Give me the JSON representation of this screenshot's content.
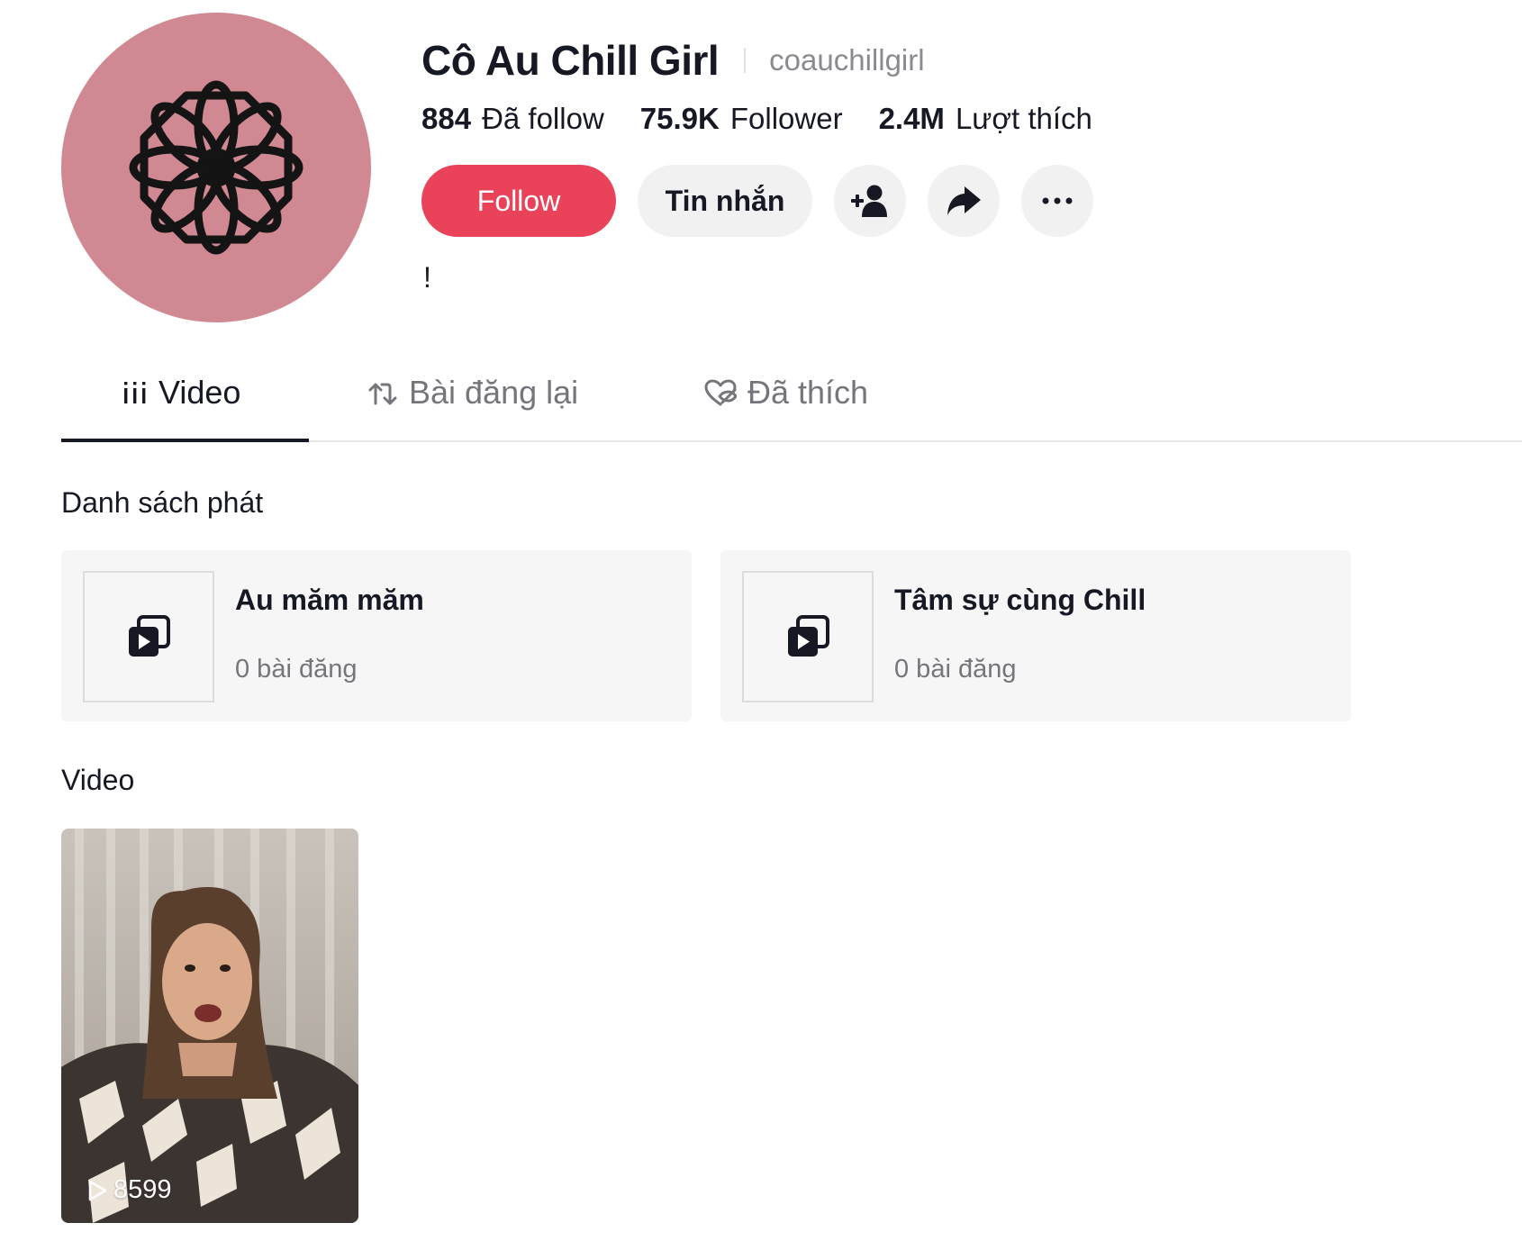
{
  "profile": {
    "display_name": "Cô Au Chill Girl",
    "username": "coauchillgirl",
    "bio": "!",
    "avatar_color": "#d08892"
  },
  "stats": [
    {
      "value": "884",
      "label": "Đã follow"
    },
    {
      "value": "75.9K",
      "label": "Follower"
    },
    {
      "value": "2.4M",
      "label": "Lượt thích"
    }
  ],
  "actions": {
    "follow_label": "Follow",
    "message_label": "Tin nhắn",
    "follow_color": "#ea4359"
  },
  "tabs": [
    {
      "label": "Video",
      "icon": "grid-icon",
      "active": true
    },
    {
      "label": "Bài đăng lại",
      "icon": "repost-icon",
      "active": false
    },
    {
      "label": "Đã thích",
      "icon": "heart-hidden-icon",
      "active": false
    }
  ],
  "playlists_section_title": "Danh sách phát",
  "playlists": [
    {
      "title": "Au măm măm",
      "count": "0 bài đăng",
      "icon": "playlist-icon"
    },
    {
      "title": "Tâm sự cùng Chill",
      "count": "0 bài đăng",
      "icon": "playlist-icon"
    }
  ],
  "videos_section_title": "Video",
  "videos": [
    {
      "views": "8599",
      "icon": "play-outline-icon"
    }
  ]
}
